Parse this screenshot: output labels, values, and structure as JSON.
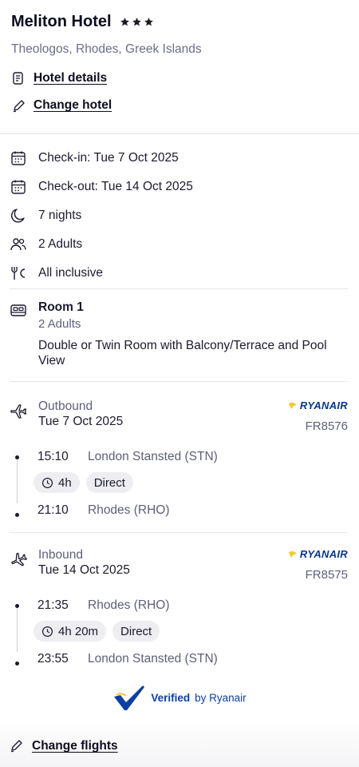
{
  "hotel": {
    "name": "Meliton Hotel",
    "stars": 3,
    "location": "Theologos, Rhodes, Greek Islands",
    "details_link": "Hotel details",
    "change_link": "Change hotel"
  },
  "facts": [
    {
      "icon": "calendar-icon",
      "text": "Check-in: Tue 7 Oct 2025"
    },
    {
      "icon": "calendar-icon",
      "text": "Check-out: Tue 14 Oct 2025"
    },
    {
      "icon": "moon-icon",
      "text": "7 nights"
    },
    {
      "icon": "people-icon",
      "text": "2 Adults"
    },
    {
      "icon": "meal-icon",
      "text": "All inclusive"
    }
  ],
  "room": {
    "title": "Room 1",
    "adults": "2 Adults",
    "description": "Double or Twin Room with Balcony/Terrace and Pool View"
  },
  "outbound": {
    "direction": "Outbound",
    "date": "Tue 7 Oct 2025",
    "airline": "RYANAIR",
    "flight_no": "FR8576",
    "depart_time": "15:10",
    "depart_place": "London Stansted (STN)",
    "duration": "4h",
    "stops": "Direct",
    "arrive_time": "21:10",
    "arrive_place": "Rhodes (RHO)"
  },
  "inbound": {
    "direction": "Inbound",
    "date": "Tue 14 Oct 2025",
    "airline": "RYANAIR",
    "flight_no": "FR8575",
    "depart_time": "21:35",
    "depart_place": "Rhodes (RHO)",
    "duration": "4h 20m",
    "stops": "Direct",
    "arrive_time": "23:55",
    "arrive_place": "London Stansted (STN)"
  },
  "verified": {
    "strong": "Verified",
    "by": "by Ryanair"
  },
  "change_flights": "Change flights",
  "colors": {
    "ryanair_blue": "#073590",
    "verified_blue": "#0b3fa3",
    "muted_text": "#5d5f7a"
  }
}
